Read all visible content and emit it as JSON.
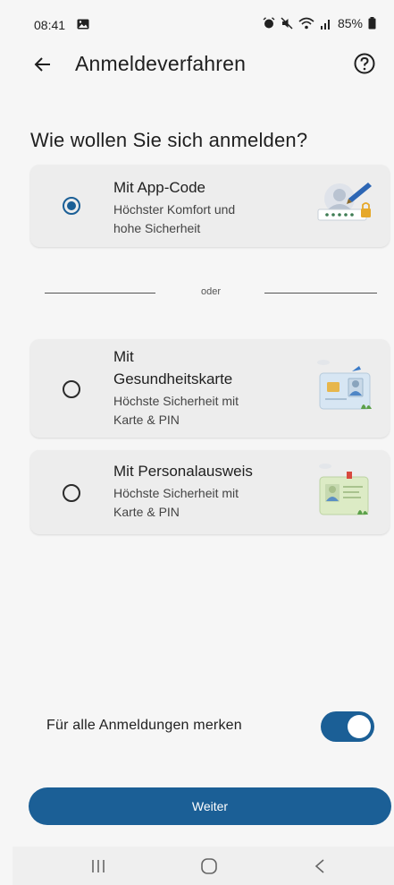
{
  "status": {
    "time": "08:41",
    "battery": "85%"
  },
  "appbar": {
    "title": "Anmeldeverfahren"
  },
  "question": "Wie wollen Sie sich anmelden?",
  "options": [
    {
      "title": "Mit App-Code",
      "subtitle_line1": "Höchster Komfort und",
      "subtitle_line2": "hohe Sicherheit",
      "selected": true
    },
    {
      "title_line1": "Mit",
      "title_line2": "Gesundheitskarte",
      "subtitle_line1": "Höchste Sicherheit mit",
      "subtitle_line2": "Karte & PIN",
      "selected": false
    },
    {
      "title": "Mit Personalausweis",
      "subtitle_line1": "Höchste Sicherheit mit",
      "subtitle_line2": "Karte & PIN",
      "selected": false
    }
  ],
  "divider_text": "oder",
  "remember": {
    "label": "Für alle Anmeldungen merken",
    "enabled": true
  },
  "primary_button": {
    "label": "Weiter"
  },
  "colors": {
    "accent": "#1b5f96",
    "background": "#f6f6f6",
    "card": "#ededed"
  },
  "icons": [
    "image-icon",
    "alarm-icon",
    "mute-icon",
    "wifi-icon",
    "signal-icon",
    "battery-icon",
    "back-arrow-icon",
    "help-icon",
    "app-code-illustration",
    "health-card-illustration",
    "id-card-illustration",
    "recent-apps-icon",
    "home-icon",
    "back-nav-icon"
  ]
}
